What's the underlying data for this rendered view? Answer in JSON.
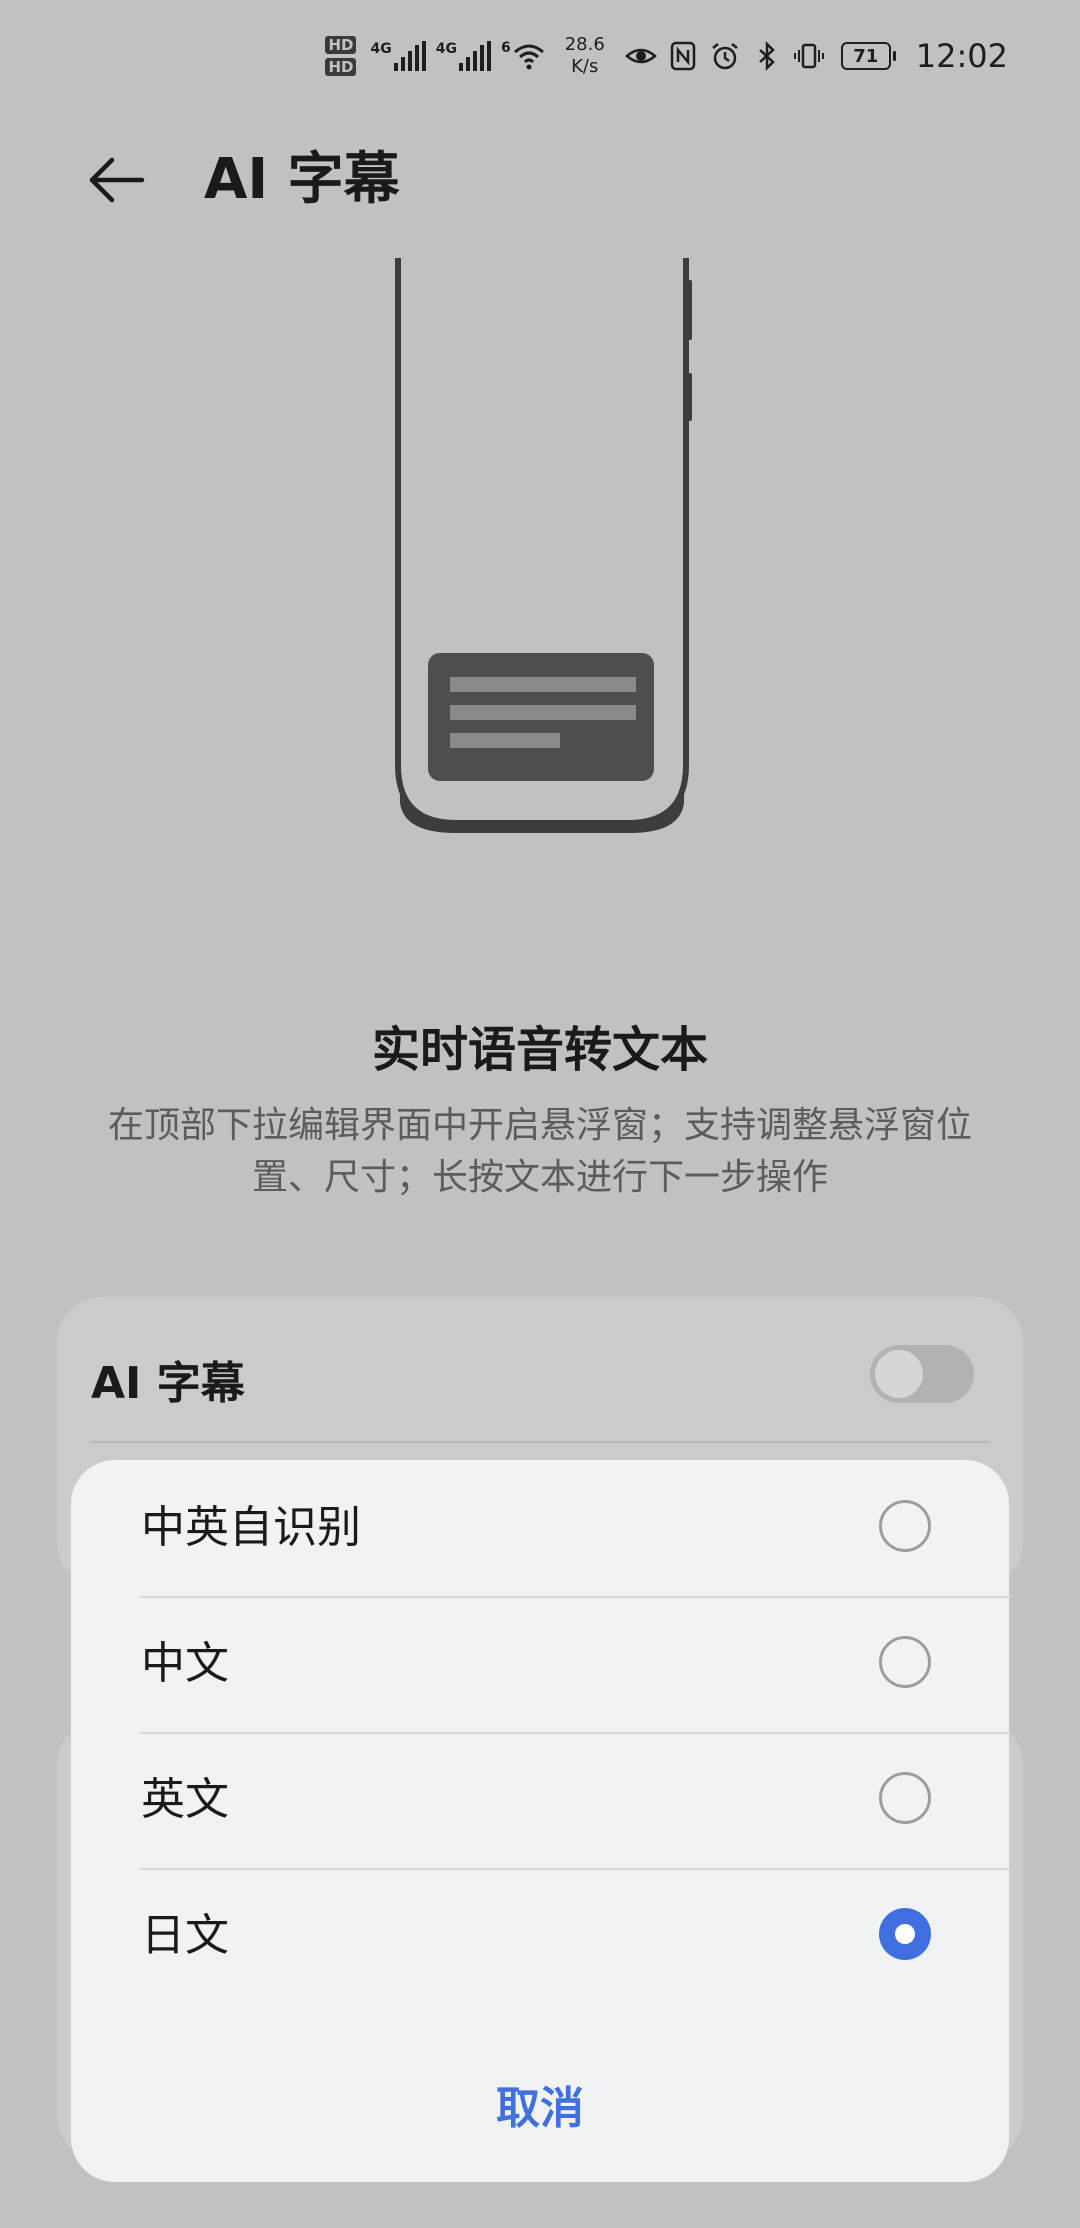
{
  "status_bar": {
    "hd1": "HD",
    "hd2": "HD",
    "net1": "4G",
    "net2": "4G",
    "wifi_gen": "6",
    "speed_value": "28.6",
    "speed_unit": "K/s",
    "battery": "71",
    "time": "12:02"
  },
  "header": {
    "title": "AI 字幕"
  },
  "feature": {
    "title": "实时语音转文本",
    "description": "在顶部下拉编辑界面中开启悬浮窗；支持调整悬浮窗位置、尺寸；长按文本进行下一步操作"
  },
  "settings": {
    "ai_caption_label": "AI 字幕",
    "ai_caption_enabled": false
  },
  "language_dialog": {
    "options": [
      {
        "label": "中英自识别",
        "selected": false
      },
      {
        "label": "中文",
        "selected": false
      },
      {
        "label": "英文",
        "selected": false
      },
      {
        "label": "日文",
        "selected": true
      }
    ],
    "cancel_label": "取消"
  },
  "colors": {
    "accent": "#3f6fe0",
    "scrim_background": "#c0c1c3",
    "dialog_background": "#f1f2f3"
  }
}
